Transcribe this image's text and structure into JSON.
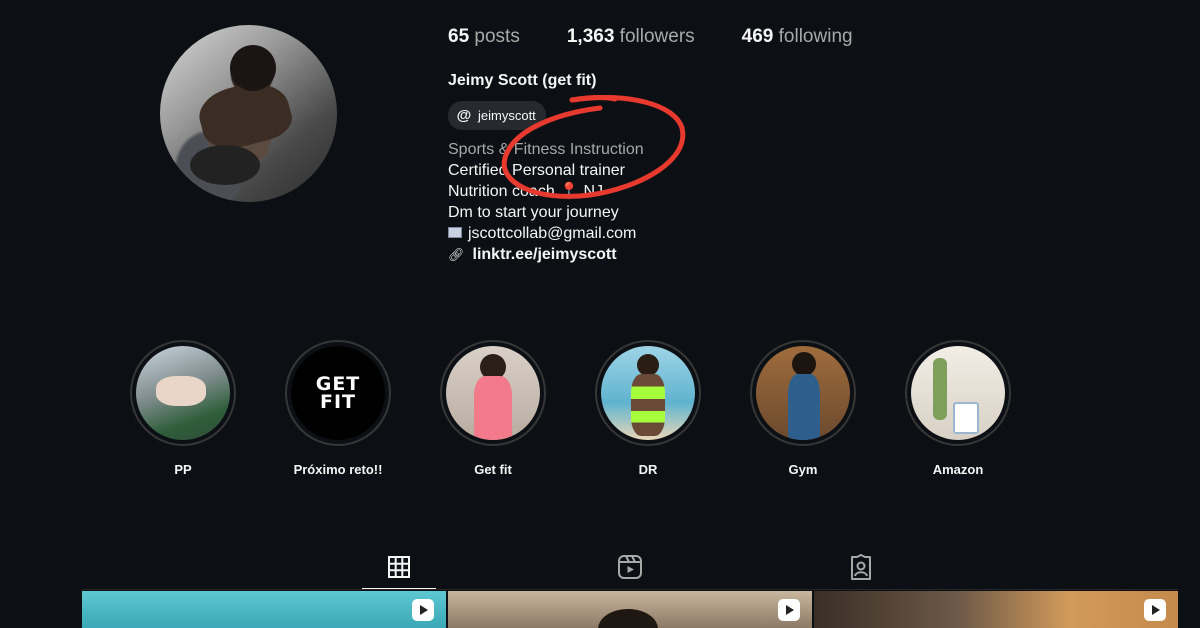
{
  "profile": {
    "stats": [
      {
        "count": "65",
        "label": "posts"
      },
      {
        "count": "1,363",
        "label": "followers"
      },
      {
        "count": "469",
        "label": "following"
      }
    ],
    "name": "Jeimy Scott (get fit)",
    "threads_handle": "jeimyscott",
    "threads_icon": "threads-icon",
    "category": "Sports & Fitness Instruction",
    "bio_lines": [
      "Certified Personal trainer",
      "Nutrition coach 📍 NJ",
      "Dm to start your journey",
      "jscottcollab@gmail.com"
    ],
    "link": "linktr.ee/jeimyscott"
  },
  "highlights": [
    {
      "label": "PP"
    },
    {
      "label": "Próximo reto!!"
    },
    {
      "label": "Get fit",
      "logo_text": "GET FIT"
    },
    {
      "label": "DR"
    },
    {
      "label": "Gym"
    },
    {
      "label": "Amazon"
    }
  ],
  "get_fit_logo": {
    "line1": "GET",
    "line2": "FIT"
  },
  "tabs": [
    {
      "name": "posts",
      "icon": "grid-icon",
      "active": true
    },
    {
      "name": "reels",
      "icon": "reels-icon",
      "active": false
    },
    {
      "name": "tagged",
      "icon": "tagged-icon",
      "active": false
    }
  ],
  "colors": {
    "background": "#0c1014",
    "annotation": "#e8392f",
    "muted_text": "#a8a8a8"
  }
}
